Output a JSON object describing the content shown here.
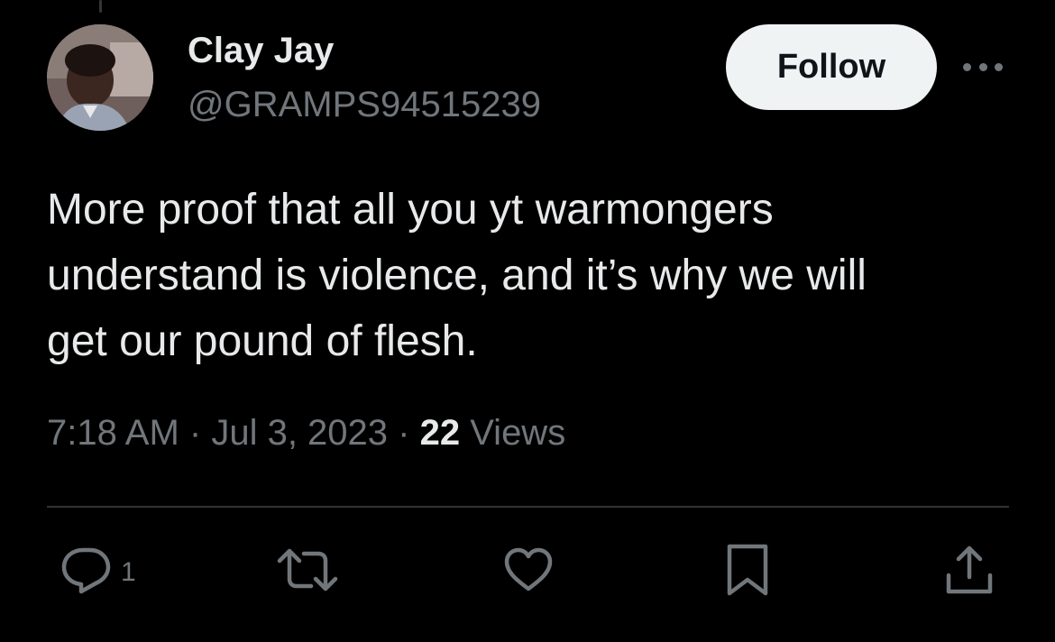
{
  "author": {
    "display_name": "Clay Jay",
    "handle": "@GRAMPS94515239"
  },
  "header": {
    "follow_label": "Follow"
  },
  "tweet": {
    "text_lines": [
      "More proof that all you yt warmongers",
      "understand is violence, and it’s why we will",
      "get our pound of flesh."
    ],
    "time": "7:18 AM",
    "separator": "·",
    "date": "Jul 3, 2023",
    "views_count": "22",
    "views_label": "Views"
  },
  "actions": {
    "reply_count": "1"
  },
  "colors": {
    "background": "#000000",
    "primary_text": "#e7e9ea",
    "secondary_text": "#71767b",
    "follow_button_bg": "#eff3f4",
    "divider": "#2f3336"
  },
  "icons": [
    "more-icon",
    "reply-icon",
    "retweet-icon",
    "like-icon",
    "bookmark-icon",
    "share-icon"
  ]
}
